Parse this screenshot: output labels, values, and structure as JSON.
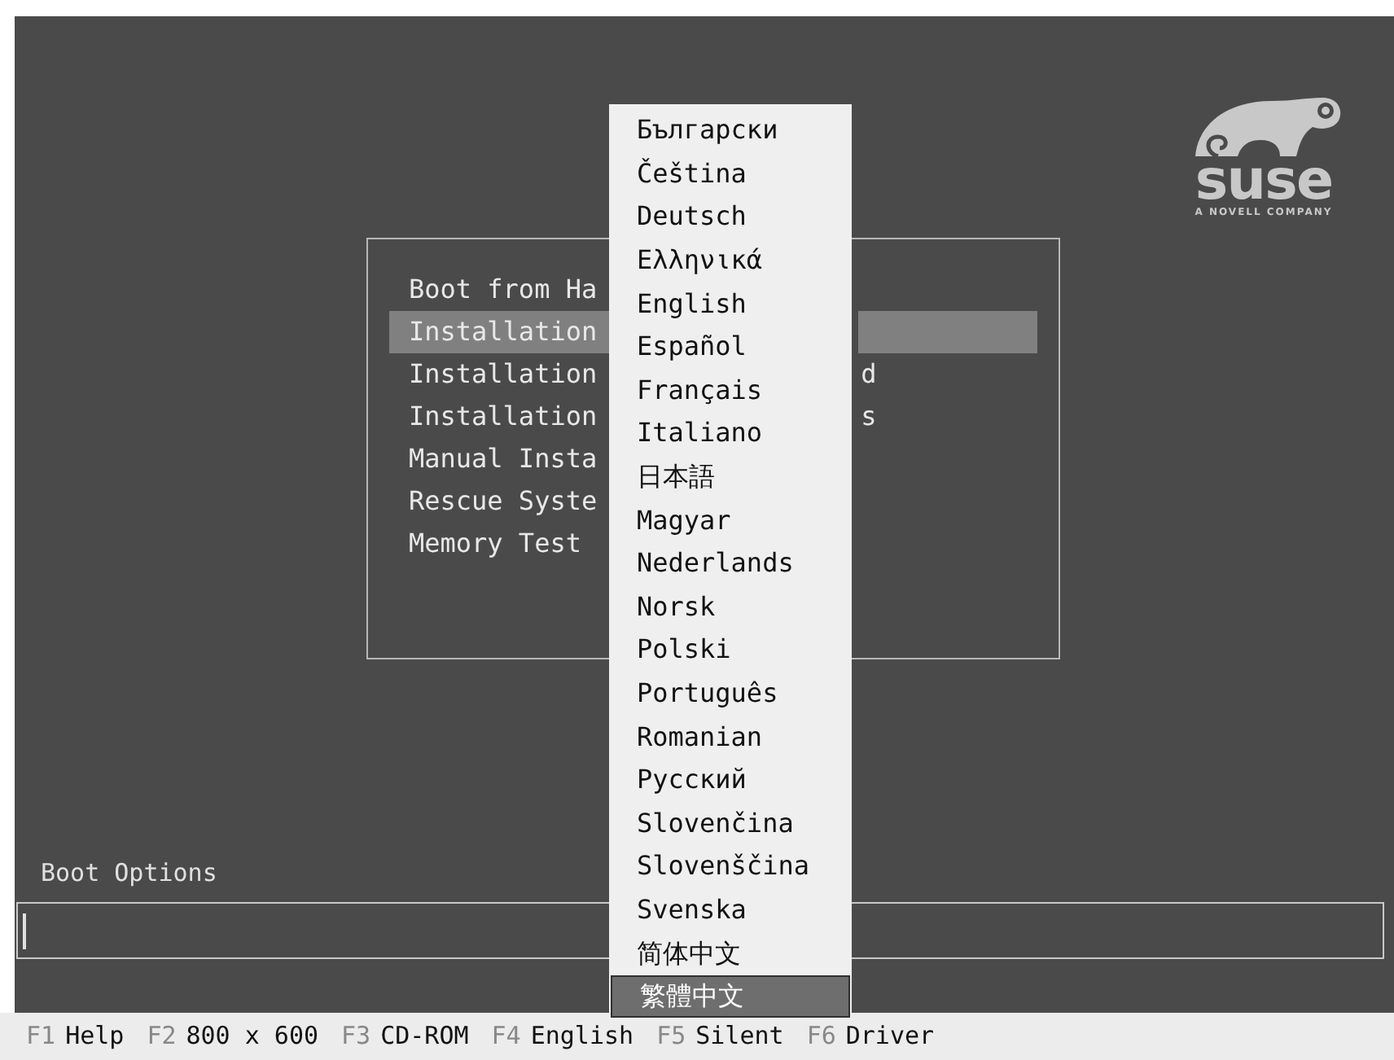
{
  "logo": {
    "wordmark": "suse",
    "tagline": "A NOVELL COMPANY"
  },
  "boot_menu": {
    "items": [
      {
        "text": "Boot from Ha",
        "selected": false
      },
      {
        "text": "Installation",
        "selected": true
      },
      {
        "text": "Installation",
        "tail": "d",
        "selected": false
      },
      {
        "text": "Installation",
        "tail": "s",
        "selected": false
      },
      {
        "text": "Manual Insta",
        "selected": false
      },
      {
        "text": "Rescue Syste",
        "selected": false
      },
      {
        "text": "Memory Test",
        "selected": false
      }
    ]
  },
  "language_menu": {
    "items": [
      {
        "label": "Български",
        "selected": false
      },
      {
        "label": "Čeština",
        "selected": false
      },
      {
        "label": "Deutsch",
        "selected": false
      },
      {
        "label": "Ελληνικά",
        "selected": false
      },
      {
        "label": "English",
        "selected": false
      },
      {
        "label": "Español",
        "selected": false
      },
      {
        "label": "Français",
        "selected": false
      },
      {
        "label": "Italiano",
        "selected": false
      },
      {
        "label": "日本語",
        "selected": false
      },
      {
        "label": "Magyar",
        "selected": false
      },
      {
        "label": "Nederlands",
        "selected": false
      },
      {
        "label": "Norsk",
        "selected": false
      },
      {
        "label": "Polski",
        "selected": false
      },
      {
        "label": "Português",
        "selected": false
      },
      {
        "label": "Romanian",
        "selected": false
      },
      {
        "label": "Русский",
        "selected": false
      },
      {
        "label": "Slovenčina",
        "selected": false
      },
      {
        "label": "Slovenščina",
        "selected": false
      },
      {
        "label": "Svenska",
        "selected": false
      },
      {
        "label": "简体中文",
        "selected": false
      },
      {
        "label": "繁體中文",
        "selected": true
      }
    ]
  },
  "boot_options": {
    "label": "Boot Options"
  },
  "function_keys": [
    {
      "key": "F1",
      "label": "Help"
    },
    {
      "key": "F2",
      "label": "800 x 600"
    },
    {
      "key": "F3",
      "label": "CD-ROM"
    },
    {
      "key": "F4",
      "label": "English"
    },
    {
      "key": "F5",
      "label": "Silent"
    },
    {
      "key": "F6",
      "label": "Driver"
    }
  ]
}
